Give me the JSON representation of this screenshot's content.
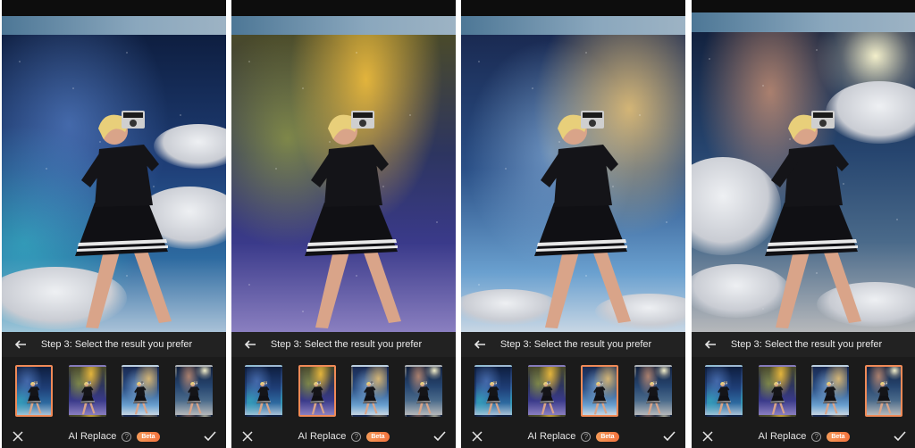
{
  "colors": {
    "accent_selected": "#f08a57",
    "beta_badge": "#f4733e",
    "toolbar_bg": "#1b1b1b",
    "text": "#e8e8e8"
  },
  "icons": {
    "back": "arrow-left-icon",
    "close": "close-icon",
    "confirm": "check-icon",
    "help": "question-circle-icon"
  },
  "panels": [
    {
      "step_label": "Step 3: Select the result you prefer",
      "feature_label": "AI Replace",
      "help_glyph": "?",
      "badge_label": "Beta",
      "selected_thumbnail": 1
    },
    {
      "step_label": "Step 3: Select the result you prefer",
      "feature_label": "AI Replace",
      "help_glyph": "?",
      "badge_label": "Beta",
      "selected_thumbnail": 2
    },
    {
      "step_label": "Step 3: Select the result you prefer",
      "feature_label": "AI Replace",
      "help_glyph": "?",
      "badge_label": "Beta",
      "selected_thumbnail": 3
    },
    {
      "step_label": "Step 3: Select the result you prefer",
      "feature_label": "AI Replace",
      "help_glyph": "?",
      "badge_label": "Beta",
      "selected_thumbnail": 4
    }
  ]
}
